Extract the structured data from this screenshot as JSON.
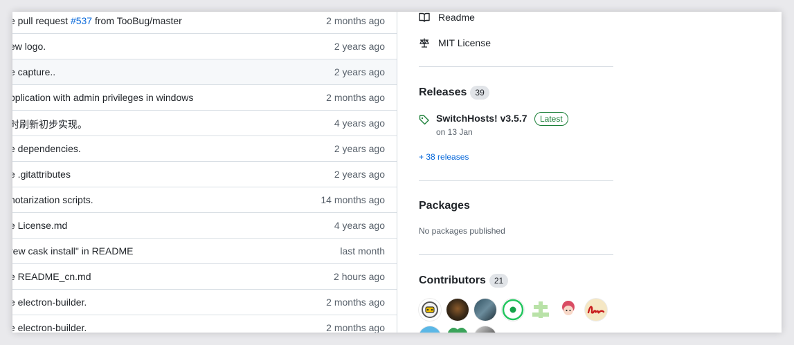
{
  "commits": [
    {
      "message_before": "e pull request ",
      "link": "#537",
      "message_after": " from TooBug/master",
      "time": "2 months ago"
    },
    {
      "message_before": "ew logo.",
      "link": "",
      "message_after": "",
      "time": "2 years ago"
    },
    {
      "message_before": "e capture..",
      "link": "",
      "message_after": "",
      "time": "2 years ago"
    },
    {
      "message_before": "pplication with admin privileges in windows",
      "link": "",
      "message_after": "",
      "time": "2 months ago"
    },
    {
      "message_before": "时刷新初步实现。",
      "link": "",
      "message_after": "",
      "time": "4 years ago"
    },
    {
      "message_before": "e dependencies.",
      "link": "",
      "message_after": "",
      "time": "2 years ago"
    },
    {
      "message_before": "e .gitattributes",
      "link": "",
      "message_after": "",
      "time": "2 years ago"
    },
    {
      "message_before": "notarization scripts.",
      "link": "",
      "message_after": "",
      "time": "14 months ago"
    },
    {
      "message_before": "e License.md",
      "link": "",
      "message_after": "",
      "time": "4 years ago"
    },
    {
      "message_before": "rew cask install\" in README",
      "link": "",
      "message_after": "",
      "time": "last month"
    },
    {
      "message_before": "e README_cn.md",
      "link": "",
      "message_after": "",
      "time": "2 hours ago"
    },
    {
      "message_before": "e electron-builder.",
      "link": "",
      "message_after": "",
      "time": "2 months ago"
    },
    {
      "message_before": "e electron-builder.",
      "link": "",
      "message_after": "",
      "time": "2 months ago"
    }
  ],
  "sidebar": {
    "readme_label": "Readme",
    "readme_icon": "book-icon",
    "license_label": "MIT License",
    "license_icon": "law-icon",
    "releases": {
      "title": "Releases",
      "count": "39",
      "latest_name": "SwitchHosts! v3.5.7",
      "latest_badge": "Latest",
      "latest_date": "on 13 Jan",
      "more_link": "+ 38 releases"
    },
    "packages": {
      "title": "Packages",
      "empty_text": "No packages published"
    },
    "contributors": {
      "title": "Contributors",
      "count": "21"
    }
  },
  "colors": {
    "link": "#0969da",
    "latest_green": "#1a7f37",
    "muted_text": "#57606a"
  }
}
